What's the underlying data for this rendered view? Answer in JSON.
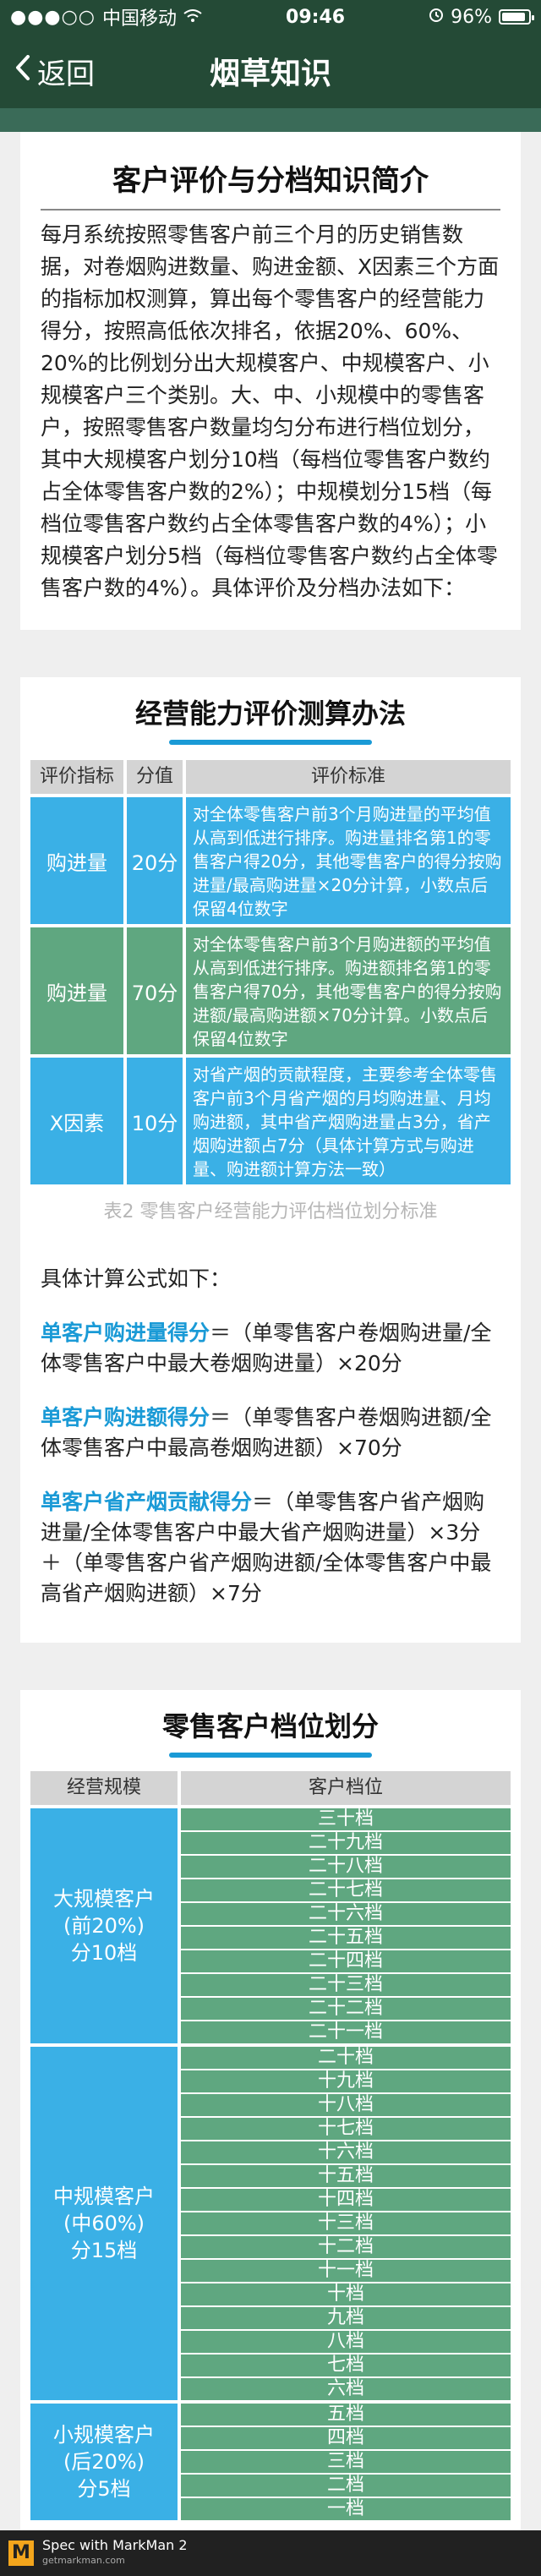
{
  "status": {
    "carrier": "中国移动",
    "time": "09:46",
    "battery": "96%",
    "battery_level": 0.96
  },
  "nav": {
    "back": "返回",
    "title": "烟草知识"
  },
  "intro": {
    "title": "客户评价与分档知识简介",
    "paragraph": "每月系统按照零售客户前三个月的历史销售数据，对卷烟购进数量、购进金额、X因素三个方面的指标加权测算，算出每个零售客户的经营能力得分，按照高低依次排名，依据20%、60%、20%的比例划分出大规模客户、中规模客户、小规模客户三个类别。大、中、小规模中的零售客户，按照零售客户数量均匀分布进行档位划分，其中大规模客户划分10档（每档位零售客户数约占全体零售客户数的2%）；中规模划分15档（每档位零售客户数约占全体零售客户数的4%）；小规模客户划分5档（每档位零售客户数约占全体零售客户数的4%）。具体评价及分档办法如下："
  },
  "ability": {
    "title": "经营能力评价测算办法",
    "headers": [
      "评价指标",
      "分值",
      "评价标准"
    ],
    "rows": [
      {
        "indicator": "购进量",
        "score": "20分",
        "standard": "对全体零售客户前3个月购进量的平均值从高到低进行排序。购进量排名第1的零售客户得20分，其他零售客户的得分按购进量/最高购进量×20分计算，小数点后保留4位数字"
      },
      {
        "indicator": "购进量",
        "score": "70分",
        "standard": "对全体零售客户前3个月购进额的平均值从高到低进行排序。购进额排名第1的零售客户得70分，其他零售客户的得分按购进额/最高购进额×70分计算。小数点后保留4位数字"
      },
      {
        "indicator": "X因素",
        "score": "10分",
        "standard": "对省产烟的贡献程度，主要参考全体零售客户前3个月省产烟的月均购进量、月均购进额，其中省产烟购进量占3分，省产烟购进额占7分（具体计算方式与购进量、购进额计算方法一致）"
      }
    ],
    "caption": "表2 零售客户经营能力评估档位划分标准"
  },
  "formulas": {
    "intro": "具体计算公式如下：",
    "items": [
      {
        "key": "单客户购进量得分",
        "text": "＝（单零售客户卷烟购进量/全体零售客户中最大卷烟购进量）×20分"
      },
      {
        "key": "单客户购进额得分",
        "text": "＝（单零售客户卷烟购进额/全体零售客户中最高卷烟购进额）×70分"
      },
      {
        "key": "单客户省产烟贡献得分",
        "text": "＝（单零售客户省产烟购进量/全体零售客户中最大省产烟购进量）×3分 ＋（单零售客户省产烟购进额/全体零售客户中最高省产烟购进额）×7分"
      }
    ]
  },
  "grading": {
    "title": "零售客户档位划分",
    "headers": [
      "经营规模",
      "客户档位"
    ],
    "groups": [
      {
        "scale": [
          "大规模客户",
          "(前20%)",
          "分10档"
        ],
        "levels": [
          "三十档",
          "二十九档",
          "二十八档",
          "二十七档",
          "二十六档",
          "二十五档",
          "二十四档",
          "二十三档",
          "二十二档",
          "二十一档"
        ]
      },
      {
        "scale": [
          "中规模客户",
          "(中60%)",
          "分15档"
        ],
        "levels": [
          "二十档",
          "十九档",
          "十八档",
          "十七档",
          "十六档",
          "十五档",
          "十四档",
          "十三档",
          "十二档",
          "十一档",
          "十档",
          "九档",
          "八档",
          "七档",
          "六档"
        ]
      },
      {
        "scale": [
          "小规模客户",
          "(后20%)",
          "分5档"
        ],
        "levels": [
          "五档",
          "四档",
          "三档",
          "二档",
          "一档"
        ]
      }
    ]
  },
  "footer": {
    "line1": "Spec with MarkMan 2",
    "line2": "getmarkman.com"
  }
}
